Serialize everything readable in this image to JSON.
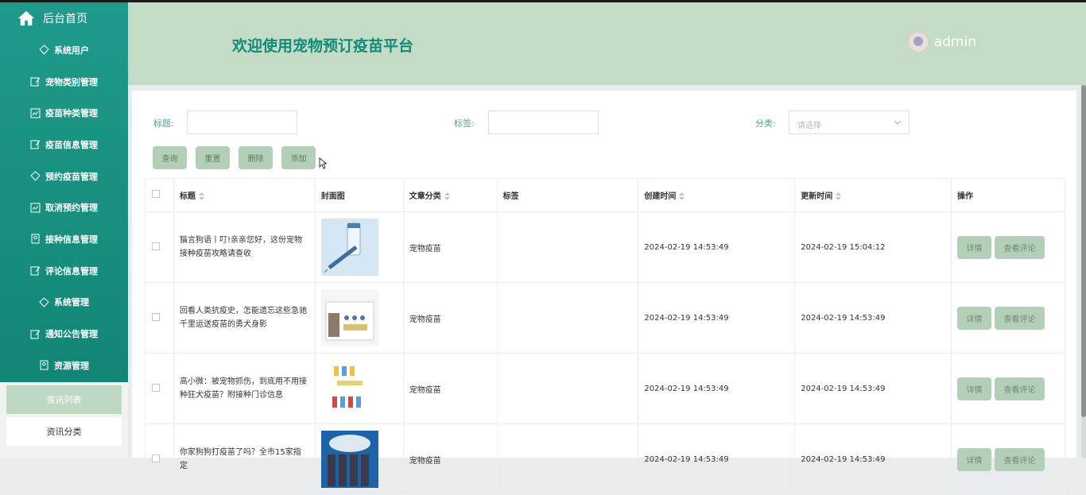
{
  "sidebar": {
    "home_label": "后台首页",
    "items": [
      {
        "label": "系统用户",
        "icon": "diamond-icon"
      },
      {
        "label": "宠物类别管理",
        "icon": "edit-icon"
      },
      {
        "label": "疫苗种类管理",
        "icon": "chart-icon"
      },
      {
        "label": "疫苗信息管理",
        "icon": "edit-icon"
      },
      {
        "label": "预约疫苗管理",
        "icon": "diamond-icon"
      },
      {
        "label": "取消预约管理",
        "icon": "chart-icon"
      },
      {
        "label": "接种信息管理",
        "icon": "badge-icon"
      },
      {
        "label": "评论信息管理",
        "icon": "edit-icon"
      },
      {
        "label": "系统管理",
        "icon": "diamond-icon"
      },
      {
        "label": "通知公告管理",
        "icon": "edit-icon"
      },
      {
        "label": "资源管理",
        "icon": "badge-icon"
      }
    ],
    "sub_items": [
      {
        "label": "资讯列表",
        "active": true
      },
      {
        "label": "资讯分类",
        "active": false
      }
    ]
  },
  "header": {
    "title": "欢迎使用宠物预订疫苗平台",
    "username": "admin"
  },
  "filters": {
    "title_label": "标题:",
    "tag_label": "标签:",
    "category_label": "分类:",
    "category_placeholder": "请选择"
  },
  "buttons": {
    "query": "查询",
    "reset": "重置",
    "delete": "删除",
    "add": "添加"
  },
  "table": {
    "columns": [
      "标题",
      "封面图",
      "文章分类",
      "标签",
      "创建时间",
      "更新时间",
      "操作"
    ],
    "rows": [
      {
        "title": "猫言狗语丨叮!亲亲您好，这份宠物接种疫苗攻略请查收",
        "category": "宠物疫苗",
        "tag": "",
        "created": "2024-02-19 14:53:49",
        "updated": "2024-02-19 15:04:12",
        "image": "vaccine-syringe-image"
      },
      {
        "title": "回看人类抗疫史，怎能遗忘这些急驰千里运送疫苗的勇犬身影",
        "category": "宠物疫苗",
        "tag": "",
        "created": "2024-02-19 14:53:49",
        "updated": "2024-02-19 14:53:49",
        "image": "vaccine-kit-image"
      },
      {
        "title": "高小微：被宠物抓伤，到底用不用接种狂犬疫苗？附接种门诊信息",
        "category": "宠物疫苗",
        "tag": "",
        "created": "2024-02-19 14:53:49",
        "updated": "2024-02-19 14:53:49",
        "image": "vaccine-vials-image"
      },
      {
        "title": "你家狗狗打疫苗了吗？全市15家指定",
        "category": "宠物疫苗",
        "tag": "",
        "created": "2024-02-19 14:53:49",
        "updated": "2024-02-19 14:53:49",
        "image": "pfizer-image"
      }
    ],
    "op_detail": "详情",
    "op_comments": "查看评论"
  },
  "colors": {
    "sidebar": "#1f9a8a",
    "header": "#c4dcc5",
    "title_text": "#128a7a",
    "button": "#b4cfb7"
  }
}
